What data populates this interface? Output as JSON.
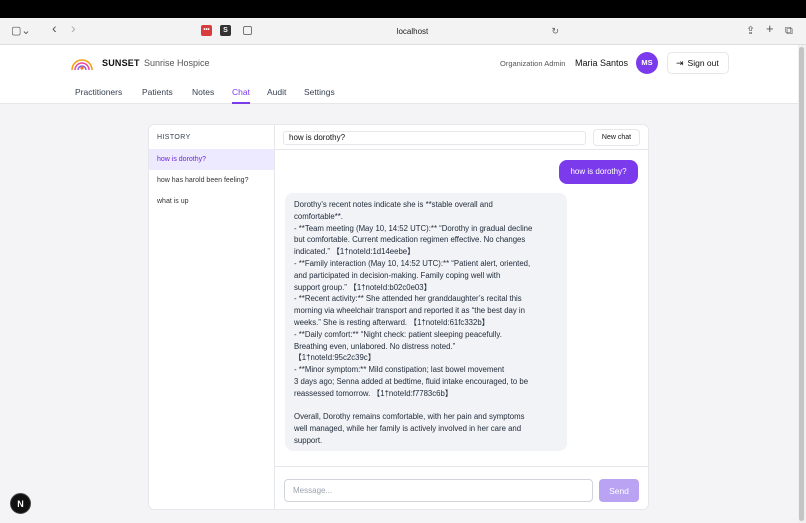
{
  "browser": {
    "url": "localhost",
    "sidebar_icon": "▢⌄",
    "back_icon": "‹",
    "forward_icon": "›",
    "reload_icon": "↻",
    "share_icon": "⇪",
    "newtab_icon": "+",
    "tabs_icon": "⧉",
    "ext_badge_1": "•••",
    "ext_badge_2": "S"
  },
  "header": {
    "brand": "SUNSET",
    "org_name": "Sunrise Hospice",
    "role": "Organization Admin",
    "user_name": "Maria Santos",
    "avatar_initials": "MS",
    "signout_icon": "⇥",
    "signout_label": "Sign out"
  },
  "nav": {
    "items": [
      {
        "label": "Practitioners"
      },
      {
        "label": "Patients"
      },
      {
        "label": "Notes"
      },
      {
        "label": "Chat"
      },
      {
        "label": "Audit"
      },
      {
        "label": "Settings"
      }
    ],
    "active": "Chat"
  },
  "history": {
    "title": "HISTORY",
    "items": [
      {
        "label": "how is dorothy?"
      },
      {
        "label": "how has harold been feeling?"
      },
      {
        "label": "what is up"
      }
    ]
  },
  "chat": {
    "title": "how is dorothy?",
    "new_chat_label": "New chat",
    "user_message": "how is dorothy?",
    "assistant_lines": [
      "Dorothy’s recent notes indicate she is **stable overall and",
      "comfortable**.",
      "- **Team meeting (May 10, 14:52 UTC):** “Dorothy in gradual decline",
      "but comfortable.  Current medication regimen effective.  No changes",
      "indicated.” 【1†noteId:1d14eebe】",
      "- **Family interaction (May 10, 14:52 UTC):** “Patient alert, oriented,",
      "and participated in decision-making.  Family coping well with",
      "support group.” 【1†noteId:b02c0e03】",
      "- **Recent activity:** She attended her granddaughter’s recital this",
      "morning via wheelchair transport and reported it as “the best day in",
      "weeks.” She is resting afterward. 【1†noteId:61fc332b】",
      "- **Daily comfort:** “Night check: patient sleeping peacefully.",
      "Breathing even, unlabored.  No distress noted.”",
      "【1†noteId:95c2c39c】",
      "- **Minor symptom:** Mild constipation; last bowel movement",
      "3 days ago; Senna added at bedtime, fluid intake encouraged, to be",
      "reassessed tomorrow. 【1†noteId:f7783c6b】",
      "",
      "Overall, Dorothy remains comfortable, with her pain and symptoms",
      "well managed, while her family is actively involved in her care and",
      "support."
    ],
    "message_placeholder": "Message...",
    "send_label": "Send"
  },
  "dev_badge": "N",
  "colors": {
    "accent": "#7c3aed",
    "send_disabled": "#b9a3f2",
    "active_history_bg": "#ede9fe"
  }
}
